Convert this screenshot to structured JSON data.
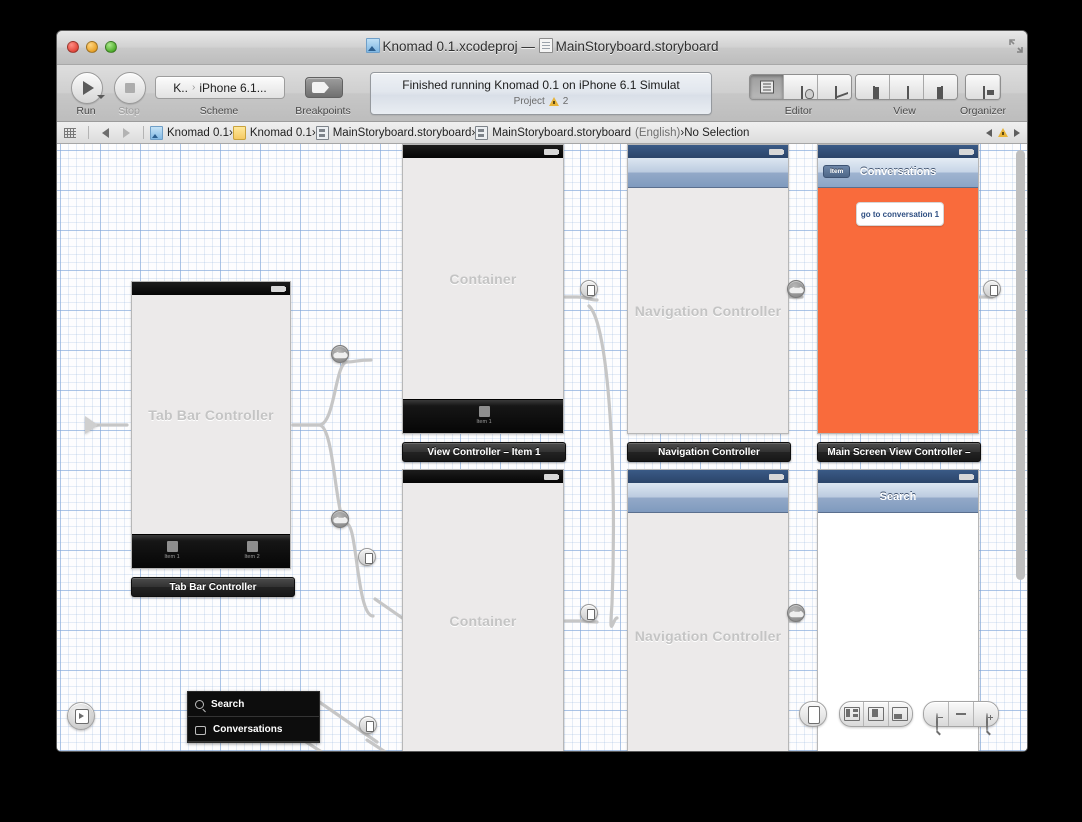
{
  "window": {
    "title_project": "Knomad 0.1.xcodeproj",
    "title_sep": "—",
    "title_file": "MainStoryboard.storyboard"
  },
  "toolbar": {
    "run_label": "Run",
    "stop_label": "Stop",
    "scheme_label": "Scheme",
    "breakpoints_label": "Breakpoints",
    "scheme_project": "K..",
    "scheme_sep": "›",
    "scheme_destination": "iPhone 6.1...",
    "editor_label": "Editor",
    "view_label": "View",
    "organizer_label": "Organizer"
  },
  "status": {
    "message": "Finished running Knomad 0.1 on iPhone 6.1 Simulat",
    "context": "Project",
    "warning_count": "2"
  },
  "jumpbar": {
    "crumb_project": "Knomad 0.1",
    "crumb_group": "Knomad 0.1",
    "crumb_file": "MainStoryboard.storyboard",
    "crumb_locale_file": "MainStoryboard.storyboard",
    "crumb_locale": "(English)",
    "crumb_selection": "No Selection",
    "chev": "›"
  },
  "scenes": {
    "tab_bar_controller": {
      "canvas_label": "Tab Bar Controller",
      "plate": "Tab Bar Controller",
      "tab_items": [
        "Item 1",
        "Item 2"
      ]
    },
    "container_top": {
      "canvas_label": "Container",
      "plate": "View Controller – Item 1",
      "tab_items": [
        "Item 1"
      ]
    },
    "container_bottom": {
      "canvas_label": "Container",
      "plate": ""
    },
    "nav_top": {
      "canvas_label": "Navigation Controller",
      "plate": "Navigation Controller"
    },
    "nav_bottom": {
      "canvas_label": "Navigation Controller",
      "plate": ""
    },
    "conversations": {
      "navbar_title": "Conversations",
      "navbar_back_item": "Item",
      "button_label": "go to conversation 1",
      "plate": "Main Screen View Controller –",
      "background_color": "#f96b3c"
    },
    "search": {
      "navbar_title": "Search"
    }
  },
  "tableview": {
    "cells": [
      {
        "icon": "magnifier-icon",
        "label": "Search"
      },
      {
        "icon": "chat-bubble-icon",
        "label": "Conversations"
      }
    ]
  },
  "canvas_controls": {
    "document_outline_toggle": "document-outline-toggle",
    "device_button": "device-orientation-button",
    "layout_buttons": [
      "align-left-icon",
      "align-center-icon",
      "align-bottom-icon"
    ],
    "zoom_buttons": [
      "zoom-out-icon",
      "zoom-actual-size-icon",
      "zoom-in-icon"
    ]
  }
}
